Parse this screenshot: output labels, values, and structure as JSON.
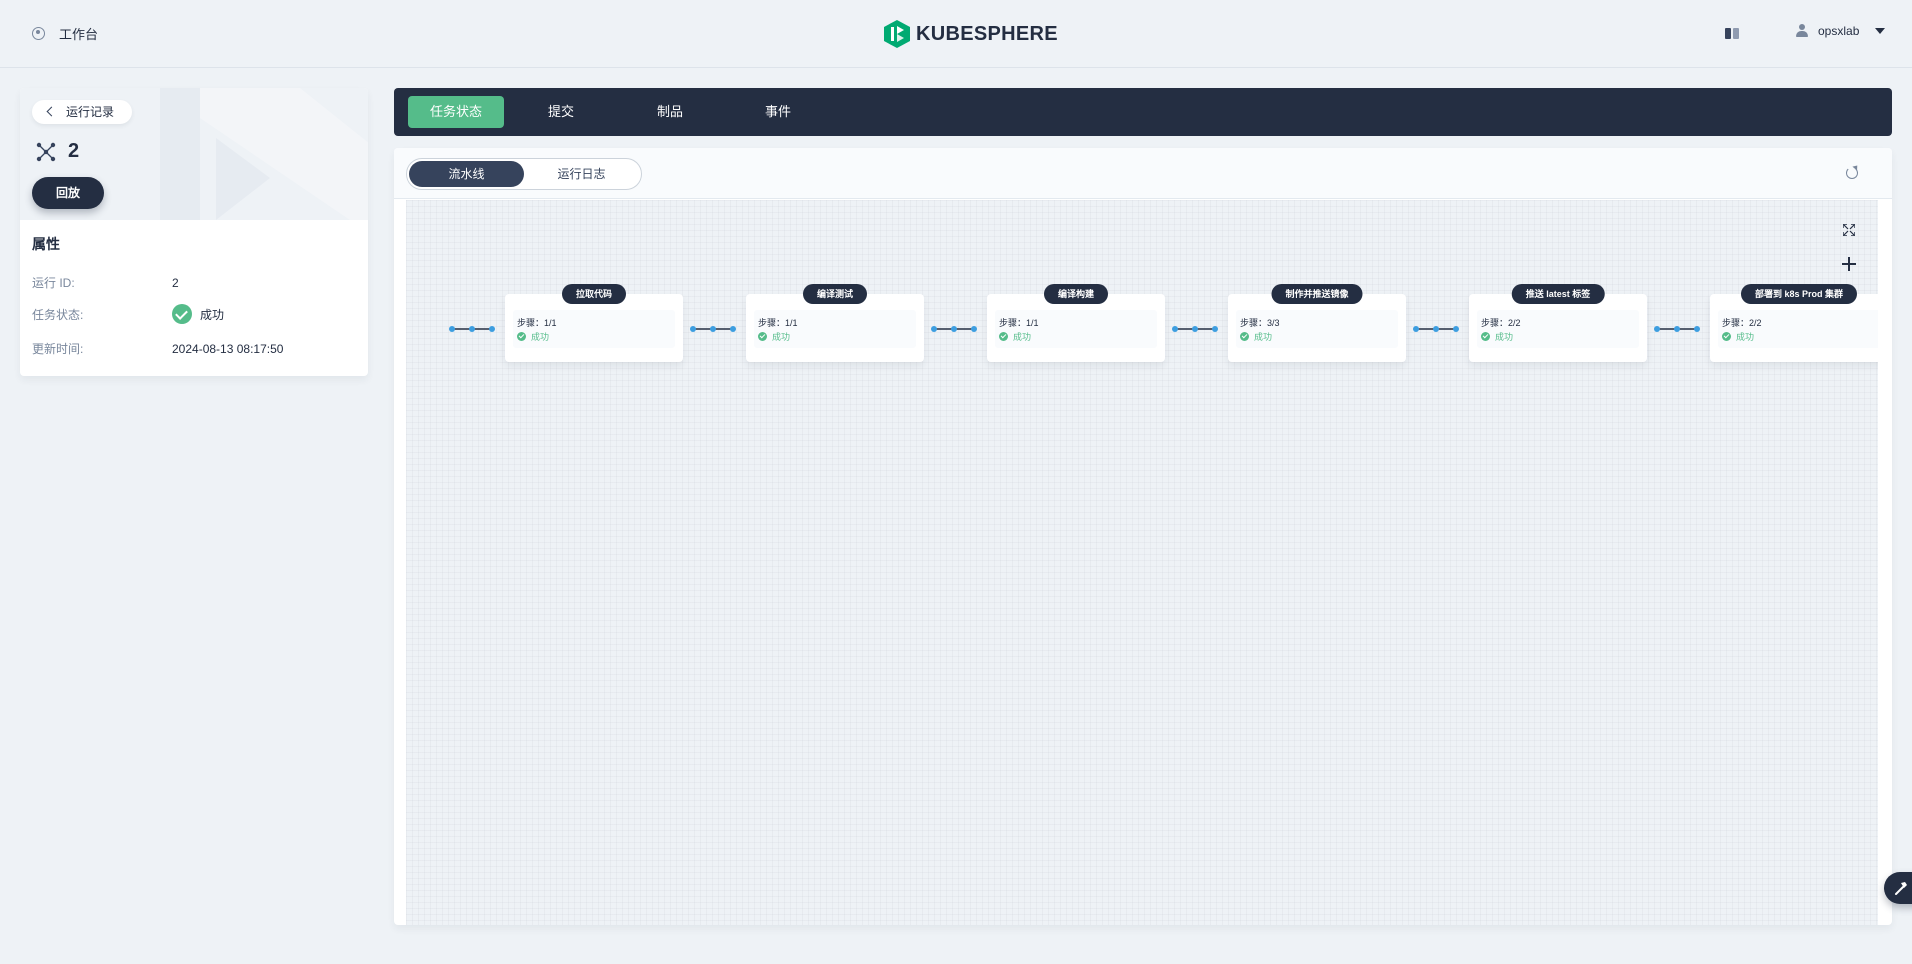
{
  "header": {
    "workbench_label": "工作台",
    "logo_text": "KUBESPHERE",
    "username": "opsxlab",
    "brand_color": "#00aa72"
  },
  "left_panel": {
    "back_label": "运行记录",
    "run_number": "2",
    "replay_label": "回放",
    "attributes_title": "属性",
    "attributes": [
      {
        "key": "运行 ID:",
        "value": "2"
      },
      {
        "key": "任务状态:",
        "value": "成功"
      },
      {
        "key": "更新时间:",
        "value": "2024-08-13 08:17:50"
      }
    ]
  },
  "tabs": [
    {
      "label": "任务状态",
      "active": true
    },
    {
      "label": "提交",
      "active": false
    },
    {
      "label": "制品",
      "active": false
    },
    {
      "label": "事件",
      "active": false
    }
  ],
  "view_switch": [
    {
      "label": "流水线",
      "active": true
    },
    {
      "label": "运行日志",
      "active": false
    }
  ],
  "pipeline": {
    "stages": [
      {
        "title": "拉取代码",
        "steps": "步骤：1/1",
        "status": "成功"
      },
      {
        "title": "编译测试",
        "steps": "步骤：1/1",
        "status": "成功"
      },
      {
        "title": "编译构建",
        "steps": "步骤：1/1",
        "status": "成功"
      },
      {
        "title": "制作并推送镜像",
        "steps": "步骤：3/3",
        "status": "成功"
      },
      {
        "title": "推送 latest 标签",
        "steps": "步骤：2/2",
        "status": "成功"
      },
      {
        "title": "部署到 k8s Prod 集群",
        "steps": "步骤：2/2",
        "status": "成功"
      }
    ]
  },
  "colors": {
    "dark": "#242e42",
    "success": "#55bc8a",
    "connector": "#3d9ee0",
    "background": "#eef2f6"
  }
}
